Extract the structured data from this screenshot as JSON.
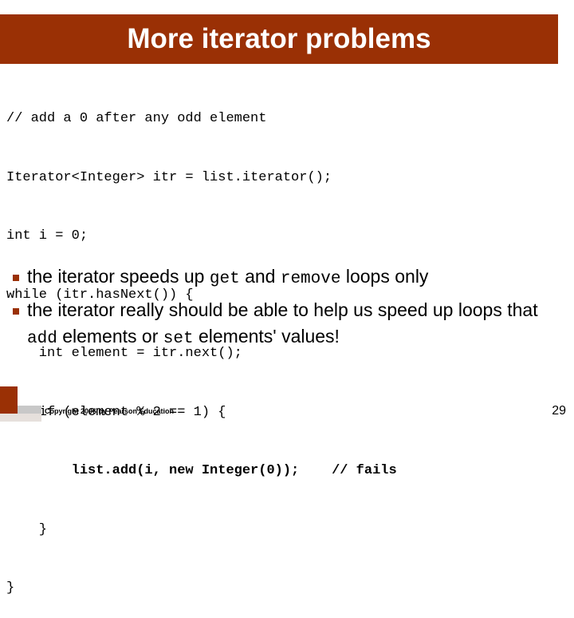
{
  "slide": {
    "title": "More iterator problems",
    "title_bg_color": "#9a3005",
    "title_text_color": "#ffffff",
    "code": {
      "lines": [
        {
          "text": "// add a 0 after any odd element",
          "bold": false
        },
        {
          "text": "Iterator<Integer> itr = list.iterator();",
          "bold": false
        },
        {
          "text": "int i = 0;",
          "bold": false
        },
        {
          "text": "while (itr.hasNext()) {",
          "bold": false
        },
        {
          "text": "    int element = itr.next();",
          "bold": false
        },
        {
          "text": "    if (element % 2 == 1) {",
          "bold": false
        },
        {
          "text": "        list.add(i, new Integer(0));    // fails",
          "bold": true
        },
        {
          "text": "    }",
          "bold": false
        },
        {
          "text": "}",
          "bold": false
        }
      ]
    },
    "bullets": [
      {
        "marker": "square-bullet",
        "parts": [
          {
            "text": "the iterator speeds up ",
            "mono": false
          },
          {
            "text": "get",
            "mono": true
          },
          {
            "text": " and ",
            "mono": false
          },
          {
            "text": "remove",
            "mono": true
          },
          {
            "text": " loops only",
            "mono": false
          }
        ]
      },
      {
        "marker": "square-bullet",
        "parts": [
          {
            "text": "the iterator really should be able to help us speed up loops that ",
            "mono": false
          },
          {
            "text": "add",
            "mono": true
          },
          {
            "text": " elements or ",
            "mono": false
          },
          {
            "text": "set",
            "mono": true
          },
          {
            "text": " elements' values!",
            "mono": false
          }
        ]
      }
    ],
    "footer": {
      "copyright": "Copyright 2006 by Pearson Education",
      "slide_number": "29"
    }
  }
}
